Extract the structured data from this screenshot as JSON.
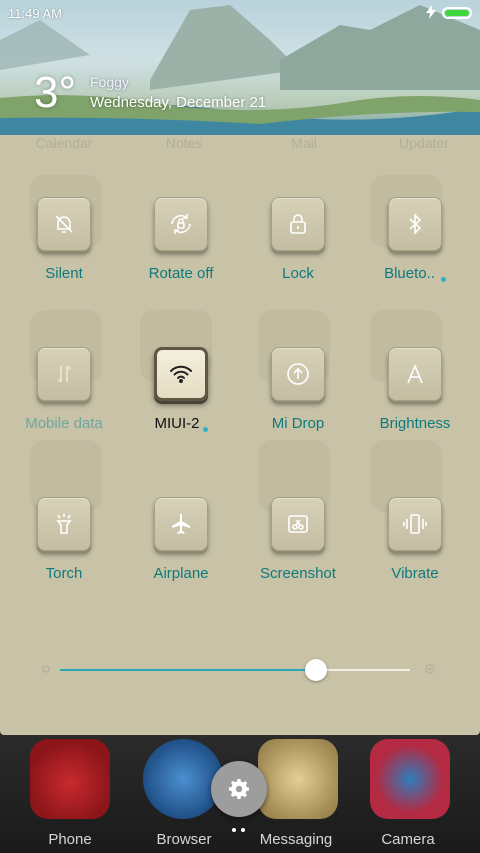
{
  "status_bar": {
    "time": "11:49 AM",
    "battery_level": 1.0
  },
  "weather": {
    "temperature": "3°",
    "condition": "Foggy",
    "date": "Wednesday, December 21"
  },
  "background_apps": [
    "Calendar",
    "Notes",
    "Mail",
    "Updater"
  ],
  "toggles": [
    {
      "label": "Silent",
      "icon": "silent-bell-icon",
      "state": "off"
    },
    {
      "label": "Rotate off",
      "icon": "rotate-lock-icon",
      "state": "off"
    },
    {
      "label": "Lock",
      "icon": "lock-icon",
      "state": "off"
    },
    {
      "label": "Blueto..",
      "icon": "bluetooth-icon",
      "state": "off",
      "has_more": true
    },
    {
      "label": "Mobile data",
      "icon": "mobile-data-icon",
      "state": "disabled"
    },
    {
      "label": "MIUI-2",
      "icon": "wifi-icon",
      "state": "on",
      "has_more": true
    },
    {
      "label": "Mi Drop",
      "icon": "mi-drop-icon",
      "state": "off"
    },
    {
      "label": "Brightness",
      "icon": "brightness-auto-icon",
      "state": "off"
    },
    {
      "label": "Torch",
      "icon": "torch-icon",
      "state": "off"
    },
    {
      "label": "Airplane",
      "icon": "airplane-icon",
      "state": "off"
    },
    {
      "label": "Screenshot",
      "icon": "screenshot-icon",
      "state": "off"
    },
    {
      "label": "Vibrate",
      "icon": "vibrate-icon",
      "state": "off"
    }
  ],
  "brightness": {
    "level": 0.73
  },
  "dock": [
    {
      "label": "Phone",
      "icon": "phone-icon",
      "color": "#b8232a"
    },
    {
      "label": "Browser",
      "icon": "browser-icon",
      "color": "#2f6fb5"
    },
    {
      "label": "Messaging",
      "icon": "messaging-icon",
      "color": "#d7c28a"
    },
    {
      "label": "Camera",
      "icon": "camera-icon",
      "color": "#b32a42"
    }
  ],
  "colors": {
    "accent": "#0f7a7d",
    "panel": "#c8c2a7",
    "slider": "#2aa7b3"
  }
}
